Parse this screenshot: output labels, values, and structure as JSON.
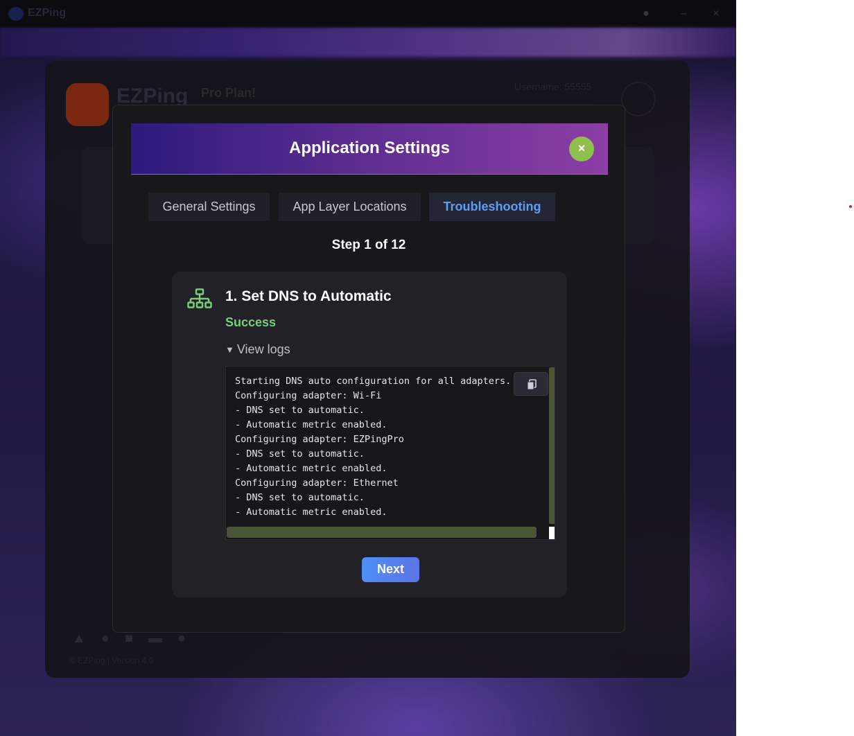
{
  "window": {
    "title": "EZPing",
    "titlebar_icons": [
      "help-icon",
      "minimize-icon",
      "close-icon"
    ]
  },
  "background_app": {
    "logo_text": "EZPing",
    "plan_badge": "Pro Plan!",
    "username_label": "Username: 55555",
    "footer_icons": [
      "network-icon",
      "gamepad-icon",
      "monitor-icon",
      "cloud-icon",
      "settings-icon"
    ],
    "version_text": "© EZPing | Version 4.0"
  },
  "modal": {
    "title": "Application Settings",
    "close_label": "×",
    "tabs": [
      {
        "label": "General Settings",
        "active": false
      },
      {
        "label": "App Layer Locations",
        "active": false
      },
      {
        "label": "Troubleshooting",
        "active": true
      }
    ],
    "step_label": "Step 1 of 12",
    "step": {
      "icon": "network-icon",
      "title": "1. Set DNS to Automatic",
      "status": "Success",
      "logs_toggle": "View logs",
      "logs": [
        "Starting DNS auto configuration for all adapters.",
        "Configuring adapter: Wi-Fi",
        "- DNS set to automatic.",
        "- Automatic metric enabled.",
        "Configuring adapter: EZPingPro",
        "- DNS set to automatic.",
        "- Automatic metric enabled.",
        "Configuring adapter: Ethernet",
        "- DNS set to automatic.",
        "- Automatic metric enabled."
      ],
      "copy_icon": "copy-icon",
      "next_label": "Next"
    }
  },
  "colors": {
    "accent_blue": "#5a9ef5",
    "success_green": "#77d07a",
    "close_green": "#8fc04c",
    "header_gradient_start": "#2d1a7e",
    "header_gradient_end": "#8c3ea6"
  }
}
